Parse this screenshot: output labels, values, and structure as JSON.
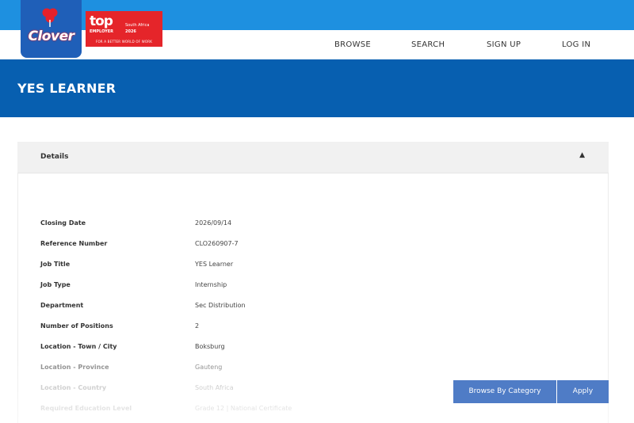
{
  "brand": {
    "logo_text": "Clover",
    "badge": {
      "line1": "top",
      "line2": "EMPLOYER",
      "country": "South Africa",
      "year": "2026",
      "tagline": "FOR A BETTER WORLD OF WORK"
    },
    "colors": {
      "top_bar": "#1e90e0",
      "banner": "#075fb0",
      "button": "#4f7cc6",
      "badge": "#e5252a"
    }
  },
  "nav": {
    "items": [
      {
        "label": "BROWSE"
      },
      {
        "label": "SEARCH"
      },
      {
        "label": "SIGN UP"
      },
      {
        "label": "LOG IN"
      }
    ]
  },
  "page": {
    "title": "YES LEARNER"
  },
  "details": {
    "heading": "Details",
    "toggle_icon": "chevron-up-icon",
    "rows": [
      {
        "label": "Closing Date",
        "value": "2026/09/14"
      },
      {
        "label": "Reference Number",
        "value": "CLO260907-7"
      },
      {
        "label": "Job Title",
        "value": "YES Learner"
      },
      {
        "label": "Job Type",
        "value": "Internship"
      },
      {
        "label": "Department",
        "value": "Sec Distribution"
      },
      {
        "label": "Number of Positions",
        "value": "2"
      },
      {
        "label": "Location - Town / City",
        "value": "Boksburg"
      },
      {
        "label": "Location - Province",
        "value": "Gauteng"
      },
      {
        "label": "Location - Country",
        "value": "South Africa"
      },
      {
        "label": "Required Education Level",
        "value": "Grade 12 | National Certificate"
      }
    ]
  },
  "actions": {
    "browse_label": "Browse By Category",
    "apply_label": "Apply"
  }
}
